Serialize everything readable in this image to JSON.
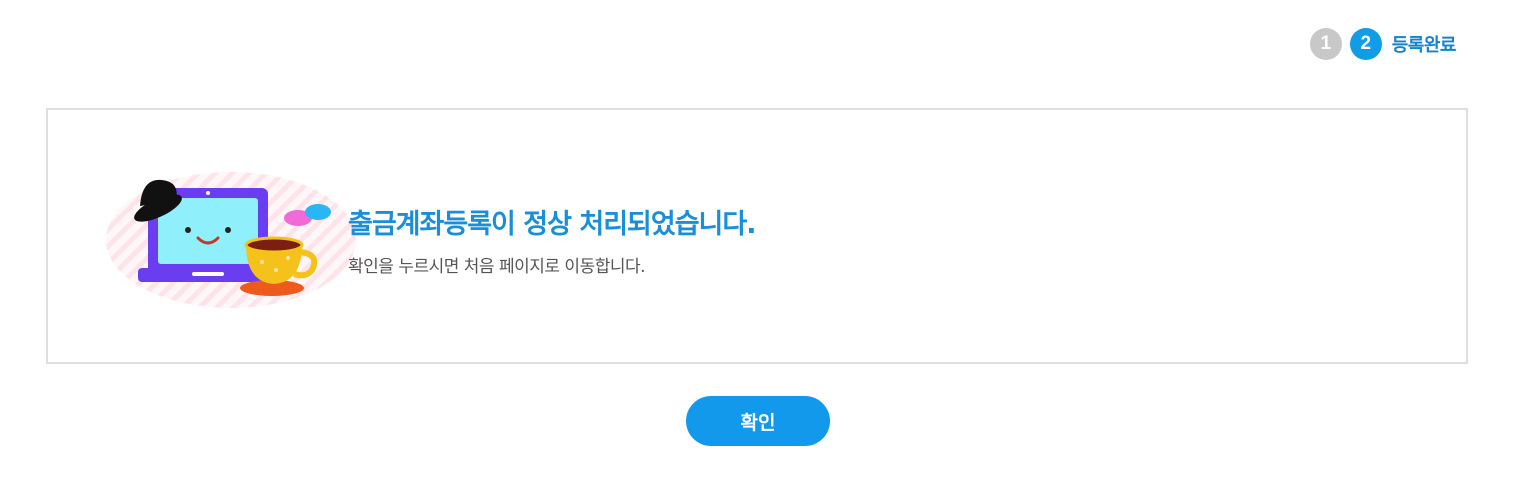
{
  "steps": {
    "items": [
      {
        "number": "1",
        "state": "inactive"
      },
      {
        "number": "2",
        "state": "active"
      }
    ],
    "current_label": "등록완료"
  },
  "message": {
    "title": "출금계좌등록이 정상 처리되었습니다.",
    "subtitle": "확인을 누르시면 처음 페이지로 이동합니다.",
    "illustration": "laptop-with-coffee-illustration"
  },
  "actions": {
    "confirm_label": "확인"
  },
  "colors": {
    "accent": "#109de6",
    "title": "#1a8fd8",
    "inactive_step": "#c8c8c8"
  }
}
